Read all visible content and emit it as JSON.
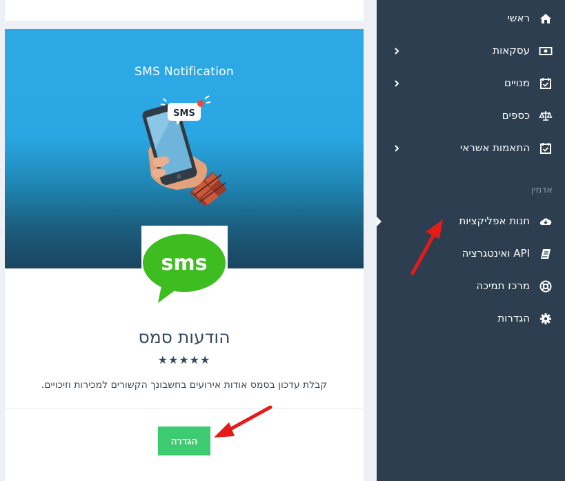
{
  "app_card": {
    "banner_title": "SMS Notification",
    "phone_badge_text": "SMS",
    "logo_text": "sms",
    "title": "הודעות סמס",
    "rating": "★★★★★",
    "description": "קבלת עדכון בסמס אודות אירועים בחשבונך הקשורים למכירות וזיכויים.",
    "setup_button": "הגדרה"
  },
  "sidebar": {
    "items": [
      {
        "label": "ראשי",
        "icon": "home-icon",
        "has_chevron": false
      },
      {
        "label": "עסקאות",
        "icon": "money-icon",
        "has_chevron": true
      },
      {
        "label": "מנויים",
        "icon": "calendar-check-icon",
        "has_chevron": true
      },
      {
        "label": "כספים",
        "icon": "balance-scale-icon",
        "has_chevron": false
      },
      {
        "label": "התאמות אשראי",
        "icon": "calendar-check-icon",
        "has_chevron": true
      }
    ],
    "section_label": "אדמין",
    "admin_items": [
      {
        "label": "חנות אפליקציות",
        "icon": "cloud-download-icon"
      },
      {
        "label": "API ואינטגרציה",
        "icon": "book-icon"
      },
      {
        "label": "מרכז תמיכה",
        "icon": "life-ring-icon"
      },
      {
        "label": "הגדרות",
        "icon": "gear-icon"
      }
    ]
  },
  "colors": {
    "sidebar_bg": "#2d3e50",
    "banner_top": "#2ea9e6",
    "banner_bottom": "#1b4460",
    "logo_green": "#3dbd1f",
    "button_green": "#3dcb72",
    "annotation_red": "#e41b17"
  }
}
